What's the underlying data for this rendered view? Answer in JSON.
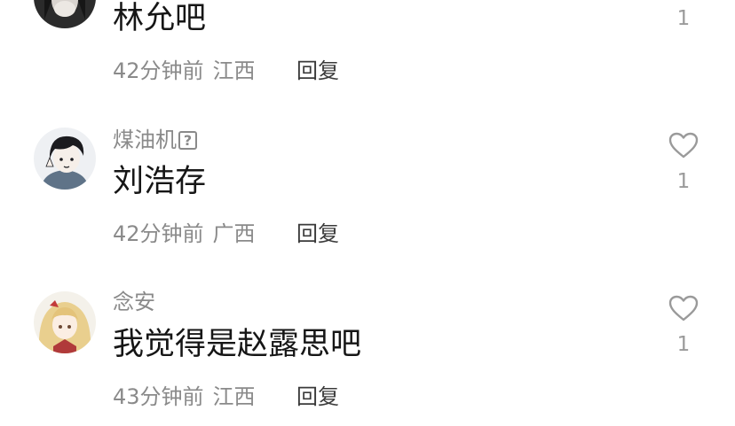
{
  "comments": [
    {
      "username": "",
      "text": "林允吧",
      "time": "42分钟前",
      "location": "江西",
      "reply_label": "回复",
      "likes": "1"
    },
    {
      "username": "煤油机",
      "badge": "?",
      "text": "刘浩存",
      "time": "42分钟前",
      "location": "广西",
      "reply_label": "回复",
      "likes": "1"
    },
    {
      "username": "念安",
      "text": "我觉得是赵露思吧",
      "time": "43分钟前",
      "location": "江西",
      "reply_label": "回复",
      "likes": "1"
    }
  ],
  "colors": {
    "meta": "#8a8a8a",
    "text": "#161616",
    "reply": "#3a3a3a",
    "heart": "#9a9a9a"
  },
  "icons": {
    "like": "heart-outline-icon",
    "badge": "question-square-icon"
  }
}
